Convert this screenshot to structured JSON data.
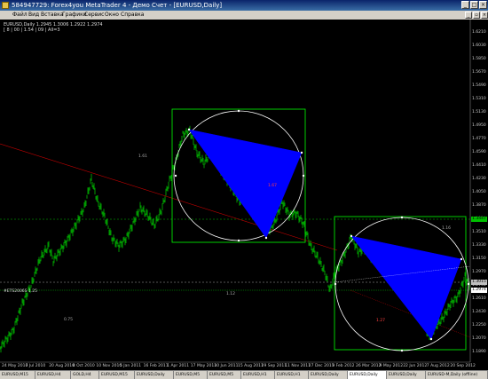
{
  "window": {
    "title": "584947729: Forex4you MetaTrader 4 - Демо Счет - [EURUSD,Daily]",
    "minimize": "_",
    "maximize": "□",
    "close": "×"
  },
  "menu": [
    "Файл",
    "Вид",
    "Вставка",
    "Графики",
    "Сервис",
    "Окно",
    "Справка"
  ],
  "chart_header": {
    "symbol_line": "EURUSD,Daily  1.2945 1.3006 1.2922 1.2974",
    "indicator_line": "[ 8 | 00 | 1.54 | 09 | All=3"
  },
  "price_axis": [
    "1.6210",
    "1.6030",
    "1.5850",
    "1.5670",
    "1.5490",
    "1.5310",
    "1.5130",
    "1.4950",
    "1.4770",
    "1.4590",
    "1.4410",
    "1.4230",
    "1.4050",
    "1.3870",
    "1.3690",
    "1.3510",
    "1.3330",
    "1.3150",
    "1.2970",
    "1.2790",
    "1.2610",
    "1.2430",
    "1.2250",
    "1.2070",
    "1.1890"
  ],
  "price_markers": {
    "upper": "1.3447",
    "current": "1.3015",
    "lower": "1.2974"
  },
  "date_axis": [
    "24 May 2010",
    "7 Jul 2010",
    "20 Aug 2010",
    "8 Oct 2010",
    "10 Nov 2010",
    "5 Jan 2011",
    "16 Feb 2011",
    "1 Apr 2011",
    "17 May 2011",
    "30 Jun 2011",
    "15 Aug 2011",
    "29 Sep 2011",
    "11 Nov 2011",
    "27 Dec 2011",
    "9 Feb 2012",
    "26 Mar 2012",
    "9 May 2012",
    "22 Jun 2012",
    "7 Aug 2012",
    "20 Sep 2012"
  ],
  "chart_labels": {
    "fib_left": "1.61",
    "fib_mid": "1.12",
    "fib_lower": "0.75",
    "fib_right": "1.16",
    "xabcd_top": "1.67",
    "xabcd_right": "1.27",
    "left_marker": "#ETS2006S 1.25",
    "right_inner": "1.618",
    "red_label": "0.88"
  },
  "colors": {
    "candles": "#00c000",
    "pattern_fill": "#0000ff",
    "box": "#00ff00",
    "circle": "#ffffff",
    "trend_red": "#c00000",
    "marker_green": "#00c000"
  },
  "tabs": [
    {
      "label": "EURUSD,M15",
      "active": false
    },
    {
      "label": "EURUSD,H4",
      "active": false
    },
    {
      "label": "GOLD,H4",
      "active": false
    },
    {
      "label": "EURUSD,M15",
      "active": false
    },
    {
      "label": "EURUSD,Daily",
      "active": false
    },
    {
      "label": "EURUSD,M5",
      "active": false
    },
    {
      "label": "EURUSD,M5",
      "active": false
    },
    {
      "label": "EURUSD,H1",
      "active": false
    },
    {
      "label": "EURUSD,H1",
      "active": false
    },
    {
      "label": "EURUSD,Daily",
      "active": false
    },
    {
      "label": "EURUSD,Daily",
      "active": true
    },
    {
      "label": "EURUSD,Daily",
      "active": false
    },
    {
      "label": "EURUSD-M,Daily (offline)",
      "active": false
    }
  ]
}
